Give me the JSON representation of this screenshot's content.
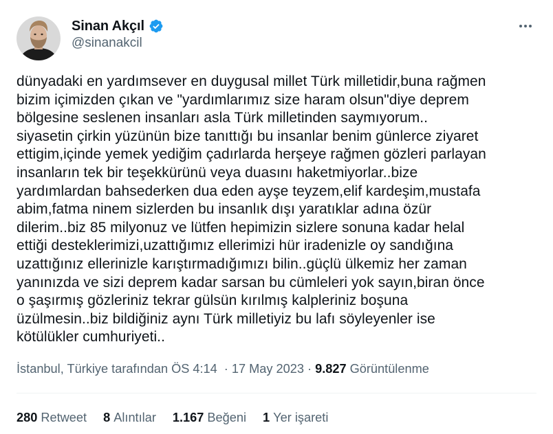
{
  "author": {
    "display_name": "Sinan Akçıl",
    "handle": "@sinanakcil",
    "verified": true,
    "verified_color": "#1d9bf0"
  },
  "tweet": {
    "text": "dünyadaki en yardımsever en duygusal millet Türk milletidir,buna rağmen\nbizim içimizden çıkan ve \"yardımlarımız size haram olsun\"diye deprem\nbölgesine seslenen insanları asla Türk milletinden saymıyorum..\nsiyasetin çirkin yüzünün bize tanıttığı bu insanlar benim günlerce ziyaret\nettigim,içinde yemek yediğim çadırlarda herşeye rağmen gözleri parlayan\ninsanların tek bir teşekkürünü veya duasını haketmiyorlar..bize\nyardımlardan bahsederken dua eden ayşe teyzem,elif kardeşim,mustafa\nabim,fatma ninem sizlerden bu insanlık dışı yaratıklar adına özür\ndilerim..biz 85 milyonuz ve lütfen hepimizin sizlere sonuna kadar helal\nettiği desteklerimizi,uzattığımız ellerimizi hür iradenizle oy sandığına\nuzattığınız ellerinizle karıştırmadığımızı bilin..güçlü ülkemiz her zaman\nyanınızda ve sizi deprem kadar sarsan bu cümleleri yok sayın,biran önce\no şaşırmış gözleriniz tekrar gülsün kırılmış kalpleriniz boşuna\nüzülmesin..biz bildiğiniz aynı Türk milletiyiz bu lafı söyleyenler ise\nkötülükler cumhuriyeti..",
    "location": "İstanbul, Türkiye tarafından",
    "time": "ÖS 4:14",
    "date": "17 May 2023",
    "views_count": "9.827",
    "views_label": "Görüntülenme"
  },
  "stats": [
    {
      "count": "280",
      "label": "Retweet"
    },
    {
      "count": "8",
      "label": "Alıntılar"
    },
    {
      "count": "1.167",
      "label": "Beğeni"
    },
    {
      "count": "1",
      "label": "Yer işareti"
    }
  ],
  "icons": {
    "more": "more-dots-icon",
    "verified": "verified-badge-icon"
  }
}
